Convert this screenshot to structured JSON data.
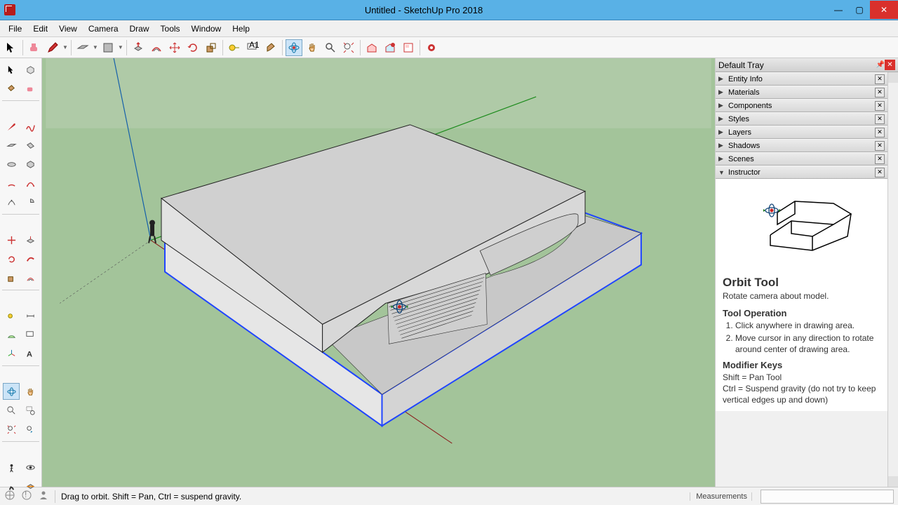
{
  "window": {
    "title": "Untitled - SketchUp Pro 2018"
  },
  "menu": [
    "File",
    "Edit",
    "View",
    "Camera",
    "Draw",
    "Tools",
    "Window",
    "Help"
  ],
  "tray": {
    "title": "Default Tray",
    "panels": [
      {
        "label": "Entity Info",
        "open": false
      },
      {
        "label": "Materials",
        "open": false
      },
      {
        "label": "Components",
        "open": false
      },
      {
        "label": "Styles",
        "open": false
      },
      {
        "label": "Layers",
        "open": false
      },
      {
        "label": "Shadows",
        "open": false
      },
      {
        "label": "Scenes",
        "open": false
      },
      {
        "label": "Instructor",
        "open": true
      }
    ]
  },
  "instructor": {
    "title": "Orbit Tool",
    "subtitle": "Rotate camera about model.",
    "op_heading": "Tool Operation",
    "steps": [
      "Click anywhere in drawing area.",
      "Move cursor in any direction to rotate around center of drawing area."
    ],
    "mod_heading": "Modifier Keys",
    "mods": [
      "Shift = Pan Tool",
      "Ctrl = Suspend gravity (do not try to keep vertical edges up and down)"
    ]
  },
  "status": {
    "hint": "Drag to orbit. Shift = Pan, Ctrl = suspend gravity.",
    "meas_label": "Measurements"
  }
}
